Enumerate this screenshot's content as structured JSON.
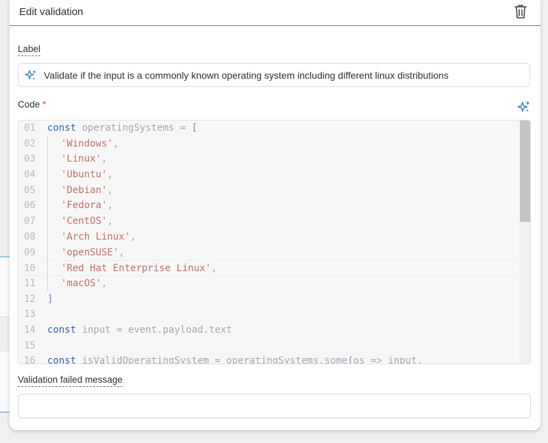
{
  "dialog": {
    "title": "Edit validation"
  },
  "label_field": {
    "label": "Label",
    "value": "Validate if the input is a commonly known operating system including different linux distributions"
  },
  "code_field": {
    "label": "Code",
    "required_mark": "*",
    "lines": [
      {
        "n": "01",
        "indent": false,
        "tokens": [
          {
            "t": "kw",
            "v": "const"
          },
          {
            "t": "id",
            "v": " operatingSystems = "
          },
          {
            "t": "br",
            "v": "["
          }
        ]
      },
      {
        "n": "02",
        "indent": true,
        "tokens": [
          {
            "t": "str",
            "v": "'Windows'"
          },
          {
            "t": "id",
            "v": ","
          }
        ]
      },
      {
        "n": "03",
        "indent": true,
        "tokens": [
          {
            "t": "str",
            "v": "'Linux'"
          },
          {
            "t": "id",
            "v": ","
          }
        ]
      },
      {
        "n": "04",
        "indent": true,
        "tokens": [
          {
            "t": "str",
            "v": "'Ubuntu'"
          },
          {
            "t": "id",
            "v": ","
          }
        ]
      },
      {
        "n": "05",
        "indent": true,
        "tokens": [
          {
            "t": "str",
            "v": "'Debian'"
          },
          {
            "t": "id",
            "v": ","
          }
        ]
      },
      {
        "n": "06",
        "indent": true,
        "tokens": [
          {
            "t": "str",
            "v": "'Fedora'"
          },
          {
            "t": "id",
            "v": ","
          }
        ]
      },
      {
        "n": "07",
        "indent": true,
        "tokens": [
          {
            "t": "str",
            "v": "'CentOS'"
          },
          {
            "t": "id",
            "v": ","
          }
        ]
      },
      {
        "n": "08",
        "indent": true,
        "tokens": [
          {
            "t": "str",
            "v": "'Arch Linux'"
          },
          {
            "t": "id",
            "v": ","
          }
        ]
      },
      {
        "n": "09",
        "indent": true,
        "tokens": [
          {
            "t": "str",
            "v": "'openSUSE'"
          },
          {
            "t": "id",
            "v": ","
          }
        ]
      },
      {
        "n": "10",
        "indent": true,
        "active": true,
        "tokens": [
          {
            "t": "str",
            "v": "'Red Hat Enterprise Linux'"
          },
          {
            "t": "id",
            "v": ","
          }
        ]
      },
      {
        "n": "11",
        "indent": true,
        "tokens": [
          {
            "t": "str",
            "v": "'macOS'"
          },
          {
            "t": "id",
            "v": ","
          }
        ]
      },
      {
        "n": "12",
        "indent": false,
        "tokens": [
          {
            "t": "br",
            "v": "]"
          }
        ]
      },
      {
        "n": "13",
        "indent": false,
        "tokens": []
      },
      {
        "n": "14",
        "indent": false,
        "tokens": [
          {
            "t": "kw",
            "v": "const"
          },
          {
            "t": "id",
            "v": " input = event.payload.text"
          }
        ]
      },
      {
        "n": "15",
        "indent": false,
        "tokens": []
      },
      {
        "n": "16",
        "indent": false,
        "tokens": [
          {
            "t": "kw",
            "v": "const"
          },
          {
            "t": "id",
            "v": " isValidOperatingSystem = operatingSystems.some"
          },
          {
            "t": "br",
            "v": "("
          },
          {
            "t": "id",
            "v": "os => input."
          }
        ]
      }
    ]
  },
  "message_field": {
    "label": "Validation failed message",
    "value": ""
  },
  "icons": {
    "delete": "trash-icon",
    "ai_label": "sparkles-icon",
    "ai_code": "sparkles-icon"
  },
  "colors": {
    "accent": "#2f7fd6",
    "required": "#d6364a",
    "keyword": "#3560b8",
    "string": "#c2706a"
  }
}
